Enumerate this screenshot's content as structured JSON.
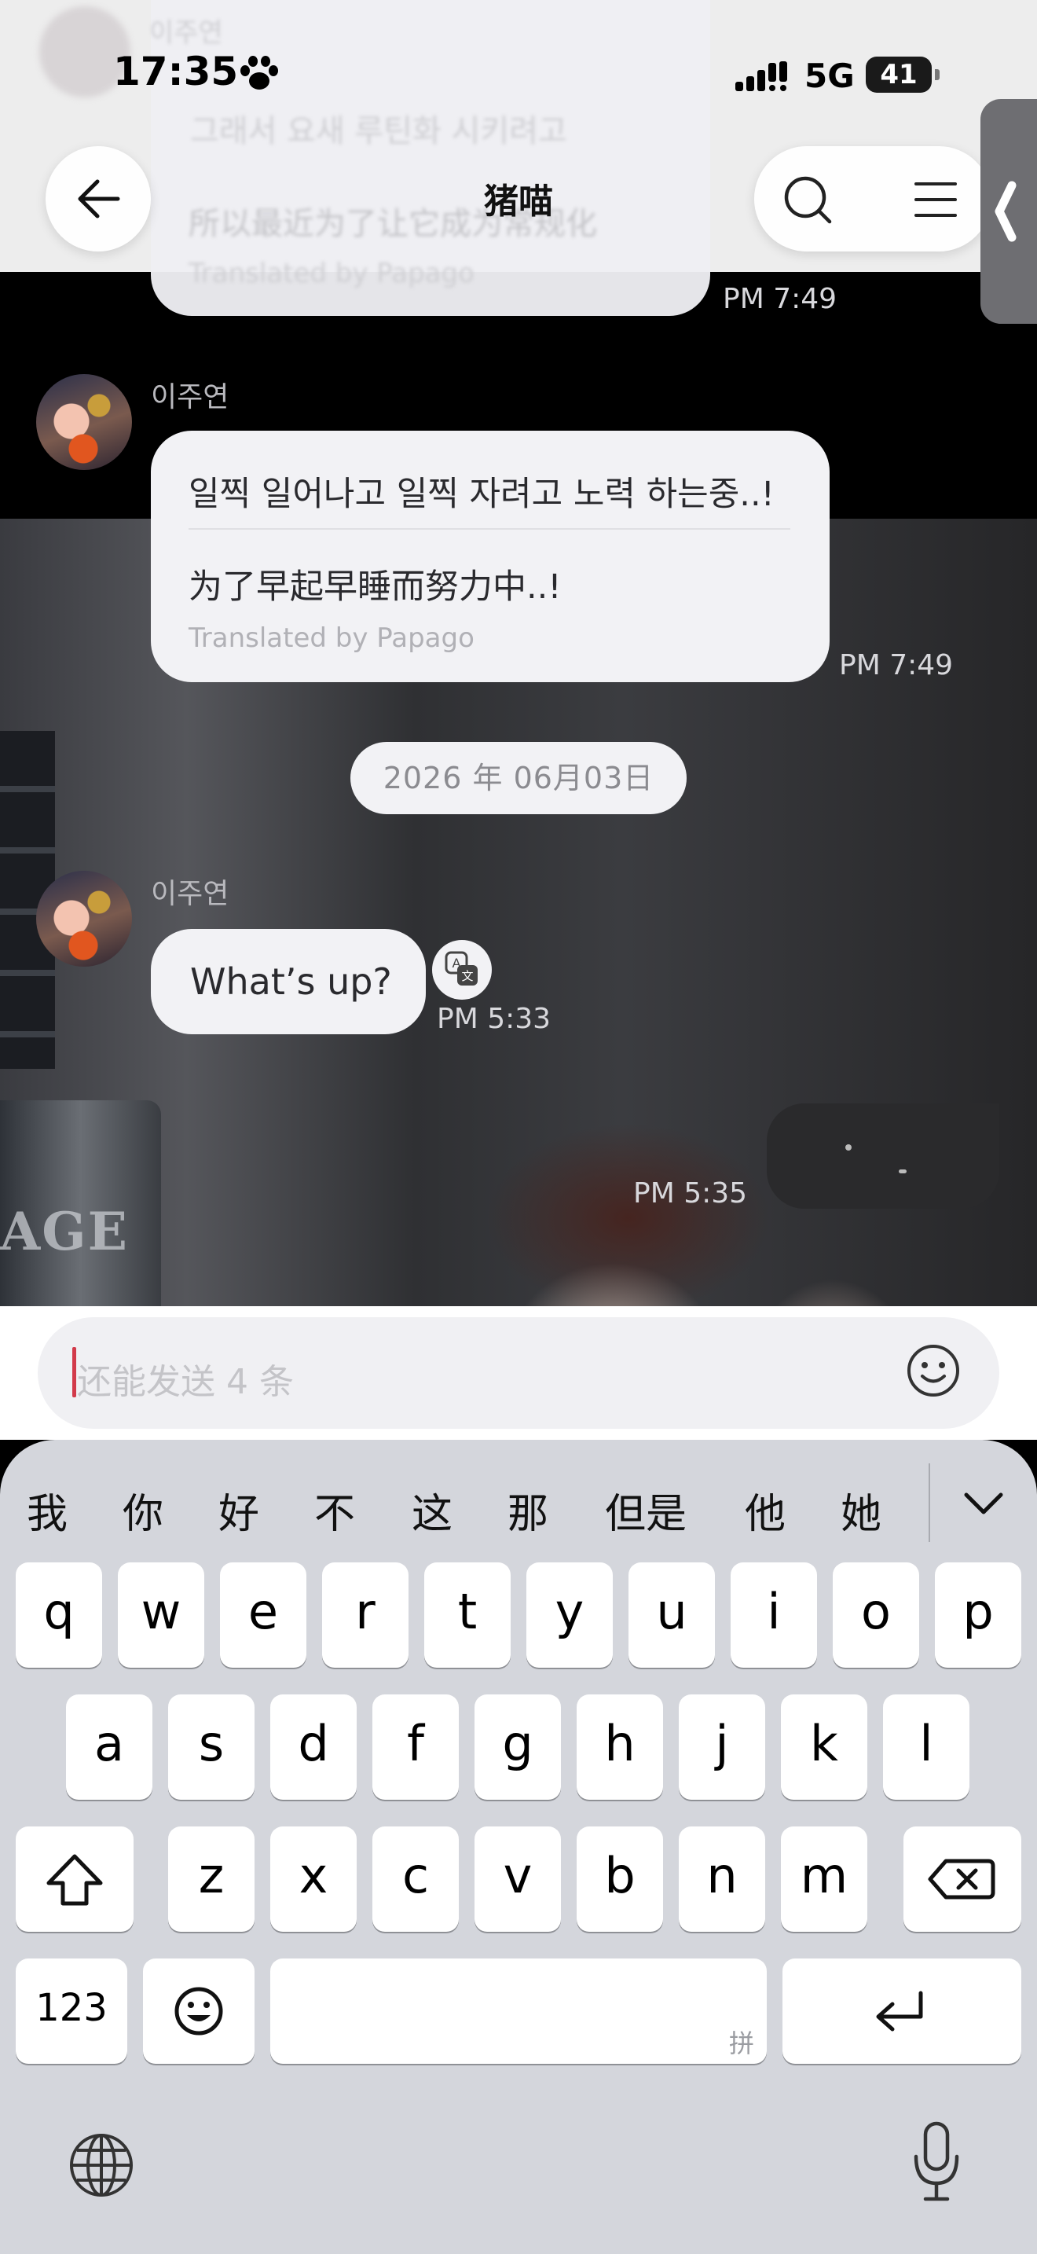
{
  "status_bar": {
    "time": "17:35",
    "network": "5G",
    "battery": "41"
  },
  "header": {
    "title": "猪喵",
    "ghost_korean": "그래서 요새 루틴화 시키려고",
    "ghost_chinese": "所以最近为了让它成为常规化",
    "ghost_translated": "Translated by Papago",
    "ghost_sender": "이주연"
  },
  "messages": [
    {
      "time": "PM 7:49"
    },
    {
      "sender": "이주연",
      "korean": "일찍 일어나고 일찍 자려고 노력 하는중..!",
      "chinese": "为了早起早睡而努力中..!",
      "translated_by": "Translated by Papago",
      "time": "PM 7:49"
    },
    {
      "date": "2026 年 06月03日"
    },
    {
      "sender": "이주연",
      "text": "What’s up?",
      "time": "PM 5:33"
    },
    {
      "time": "PM 5:35"
    }
  ],
  "wallpaper_text": "AGE",
  "input": {
    "placeholder": "还能发送 4 条"
  },
  "keyboard": {
    "candidates": [
      "我",
      "你",
      "好",
      "不",
      "这",
      "那",
      "但是",
      "他",
      "她"
    ],
    "row1": [
      "q",
      "w",
      "e",
      "r",
      "t",
      "y",
      "u",
      "i",
      "o",
      "p"
    ],
    "row2": [
      "a",
      "s",
      "d",
      "f",
      "g",
      "h",
      "j",
      "k",
      "l"
    ],
    "row3": [
      "z",
      "x",
      "c",
      "v",
      "b",
      "n",
      "m"
    ],
    "numbers_key": "123",
    "space_hint": "拼"
  },
  "colors": {
    "accent_caret": "#d23a4a",
    "bubble": "#f2f2f5",
    "keyboard_bg": "#d4d6dc"
  },
  "icons": [
    "back-arrow-icon",
    "search-icon",
    "menu-icon",
    "collapse-tab-icon",
    "translate-icon",
    "emoji-icon",
    "chevron-down-icon",
    "shift-icon",
    "backspace-icon",
    "emoji-keyboard-icon",
    "return-icon",
    "globe-icon",
    "microphone-icon",
    "paw-icon",
    "signal-icon",
    "battery-icon"
  ]
}
